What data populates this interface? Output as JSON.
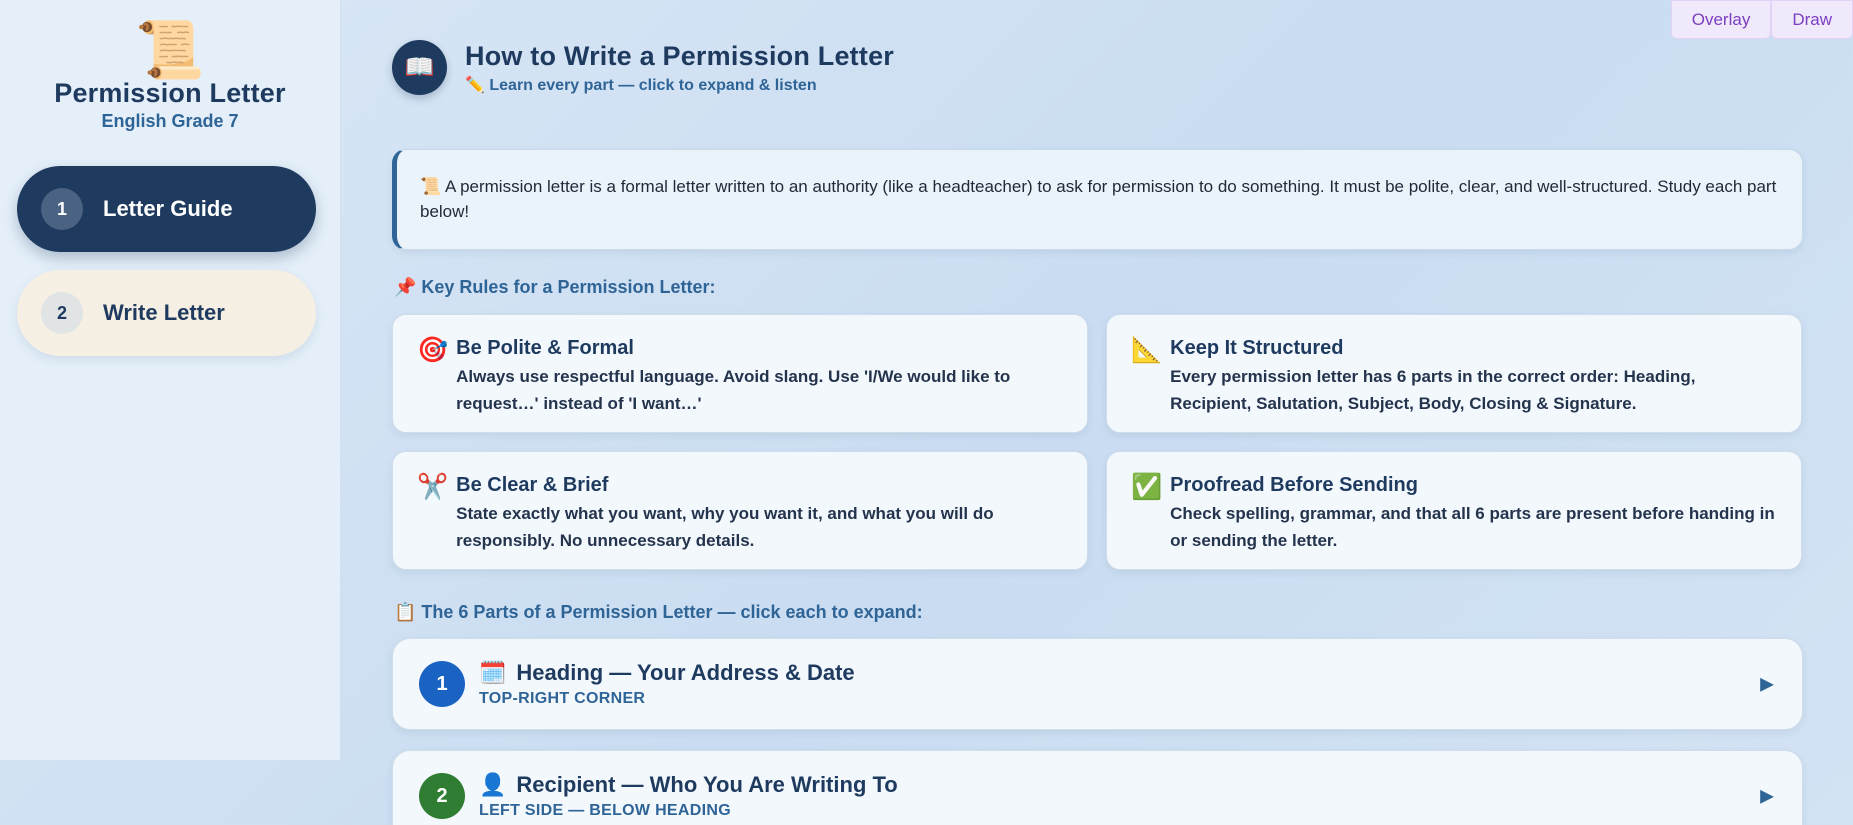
{
  "sidebar": {
    "brand_icon": "📜",
    "title": "Permission Letter",
    "subtitle": "English Grade 7",
    "items": [
      {
        "num": "1",
        "label": "Letter Guide"
      },
      {
        "num": "2",
        "label": "Write Letter"
      }
    ]
  },
  "tools": {
    "overlay": "Overlay",
    "draw": "Draw"
  },
  "header": {
    "icon": "📖",
    "title": "How to Write a Permission Letter",
    "subtitle": "✏️ Learn every part — click to expand & listen"
  },
  "intro": "📜 A permission letter is a formal letter written to an authority (like a headteacher) to ask for permission to do something. It must be polite, clear, and well-structured. Study each part below!",
  "rules_heading": "📌 Key Rules for a Permission Letter:",
  "rules": [
    {
      "icon": "🎯",
      "title": "Be Polite & Formal",
      "text": "Always use respectful language. Avoid slang. Use 'I/We would like to request…' instead of 'I want…'"
    },
    {
      "icon": "📐",
      "title": "Keep It Structured",
      "text": "Every permission letter has 6 parts in the correct order: Heading, Recipient, Salutation, Subject, Body, Closing & Signature."
    },
    {
      "icon": "✂️",
      "title": "Be Clear & Brief",
      "text": "State exactly what you want, why you want it, and what you will do responsibly. No unnecessary details."
    },
    {
      "icon": "✅",
      "title": "Proofread Before Sending",
      "text": "Check spelling, grammar, and that all 6 parts are present before handing in or sending the letter."
    }
  ],
  "parts_heading": "📋 The 6 Parts of a Permission Letter — click each to expand:",
  "parts": [
    {
      "num": "1",
      "icon": "🗓️",
      "title": "Heading — Your Address & Date",
      "location": "TOP-RIGHT CORNER",
      "color": "#1a63c2",
      "arrow": "▶"
    },
    {
      "num": "2",
      "icon": "👤",
      "title": "Recipient — Who You Are Writing To",
      "location": "LEFT SIDE — BELOW HEADING",
      "color": "#2e7d32",
      "arrow": "▶"
    }
  ]
}
